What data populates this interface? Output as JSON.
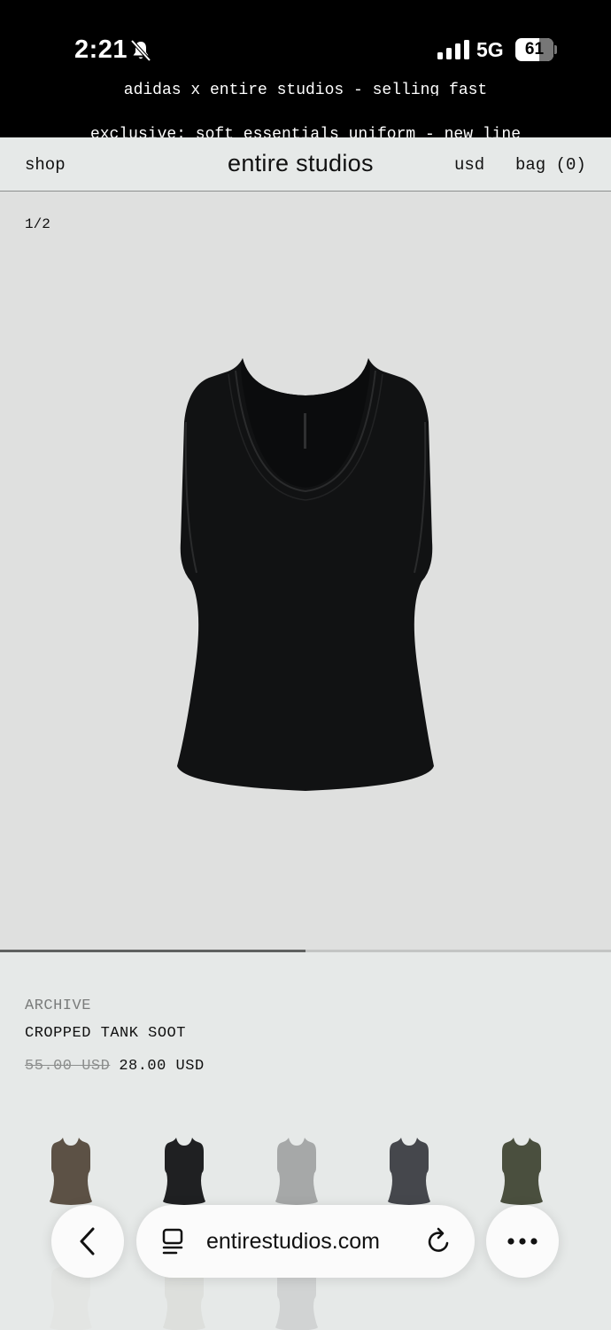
{
  "status_bar": {
    "time": "2:21",
    "network": "5G",
    "battery": "61"
  },
  "announcements": {
    "line1": "adidas x entire studios - selling fast",
    "line2": "exclusive: soft essentials uniform - new line"
  },
  "header": {
    "shop": "shop",
    "logo": "entire studios",
    "currency": "usd",
    "bag": "bag (0)"
  },
  "gallery": {
    "counter": "1/2",
    "current_image": 1,
    "total_images": 2
  },
  "product": {
    "label": "ARCHIVE",
    "name": "CROPPED TANK SOOT",
    "original_price": "55.00 USD",
    "sale_price": "28.00 USD"
  },
  "swatches": [
    {
      "name": "brown",
      "color": "#5c5145"
    },
    {
      "name": "soot",
      "color": "#1f2022"
    },
    {
      "name": "grey",
      "color": "#a6a8a8"
    },
    {
      "name": "charcoal",
      "color": "#45474c"
    },
    {
      "name": "olive",
      "color": "#4a4f3e"
    }
  ],
  "swatches_row2": [
    {
      "name": "white",
      "color": "#dcdcd8"
    },
    {
      "name": "cream",
      "color": "#c8c7bf"
    },
    {
      "name": "light-grey",
      "color": "#9c9e9e"
    }
  ],
  "browser": {
    "url": "entirestudios.com"
  },
  "colors": {
    "background": "#e6e9e8",
    "gallery_bg": "#dfe0df",
    "text": "#111111",
    "muted": "#7a7c7b"
  }
}
